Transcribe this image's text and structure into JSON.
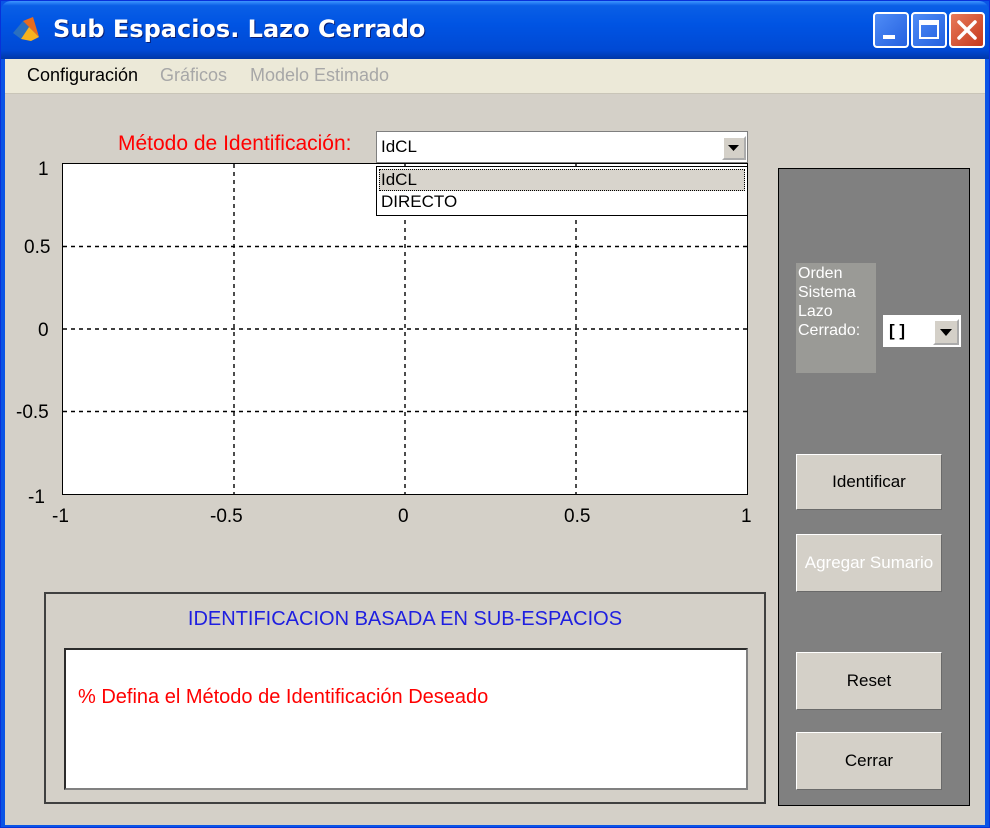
{
  "window": {
    "title": "Sub Espacios. Lazo Cerrado",
    "accent": "#0054e3"
  },
  "menu": {
    "items": [
      {
        "label": "Configuración",
        "enabled": true
      },
      {
        "label": "Gráficos",
        "enabled": false
      },
      {
        "label": "Modelo Estimado",
        "enabled": false
      }
    ]
  },
  "method": {
    "label": "Método de Identificación:",
    "selected": "IdCL",
    "options": [
      "IdCL",
      "DIRECTO"
    ]
  },
  "chart_data": {
    "type": "line",
    "series": [],
    "xlim": [
      -1,
      1
    ],
    "ylim": [
      -1,
      1
    ],
    "xticks": [
      "-1",
      "-0.5",
      "0",
      "0.5",
      "1"
    ],
    "yticks": [
      "1",
      "0.5",
      "0",
      "-0.5",
      "-1"
    ],
    "grid": true,
    "grid_style": "dashed"
  },
  "order": {
    "label": "Orden\nSistema\nLazo\nCerrado:",
    "selected": "[ ]"
  },
  "buttons": {
    "identificar": "Identificar",
    "agregar_sumario": "Agregar Sumario",
    "reset": "Reset",
    "cerrar": "Cerrar"
  },
  "summary": {
    "title": "IDENTIFICACION BASADA EN SUB-ESPACIOS",
    "message": "% Defina el Método de Identificación Deseado"
  }
}
